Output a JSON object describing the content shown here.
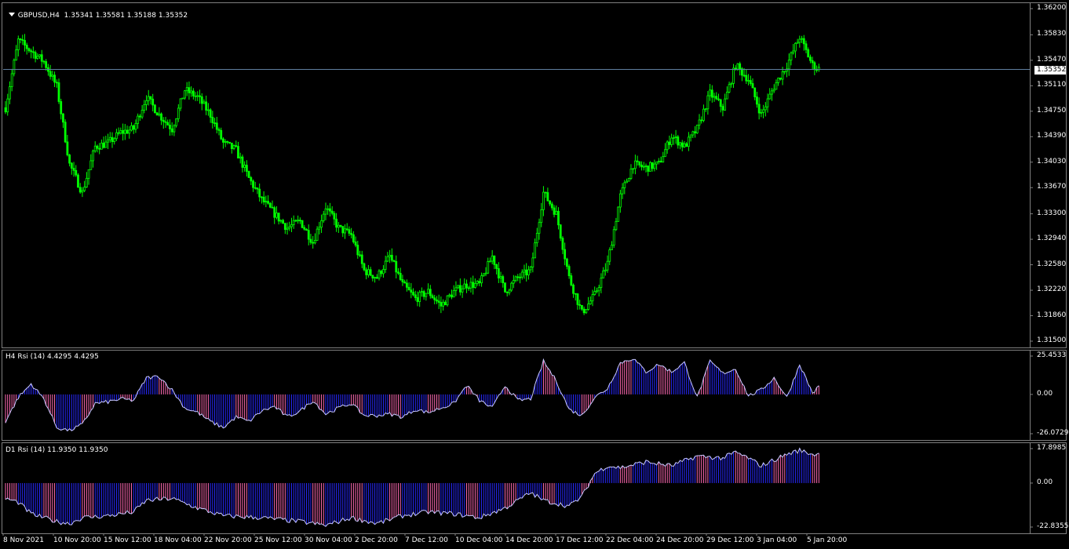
{
  "panels": {
    "main": {
      "symbol": "GBPUSD,H4",
      "ohlc": "1.35341 1.35581 1.35188 1.35352"
    },
    "h4": {
      "label": "H4 Rsi (14) 4.4295 4.4295"
    },
    "d1": {
      "label": "D1 Rsi (14) 11.9350 11.9350"
    }
  },
  "price_tag": "1.35352",
  "colors": {
    "bull": "#00ff00",
    "bear": "#00ff00",
    "hist_pos_a": "#ff69b4",
    "hist_pos_b": "#2828ff",
    "line": "#c8c8ff",
    "grid": "#808080",
    "price_line": "#5f7f9f"
  },
  "chart_data": [
    {
      "type": "candlestick",
      "title": "GBPUSD,H4",
      "ylim": [
        1.315,
        1.362
      ],
      "y_ticks": [
        "1.36200",
        "1.35830",
        "1.35470",
        "1.35110",
        "1.34750",
        "1.34390",
        "1.34030",
        "1.33670",
        "1.33300",
        "1.32940",
        "1.32580",
        "1.32220",
        "1.31860",
        "1.31500"
      ],
      "x_ticks": [
        "8 Nov 2021",
        "10 Nov 20:00",
        "15 Nov 12:00",
        "18 Nov 04:00",
        "22 Nov 20:00",
        "25 Nov 12:00",
        "30 Nov 04:00",
        "2 Dec 20:00",
        "7 Dec 12:00",
        "10 Dec 04:00",
        "14 Dec 20:00",
        "17 Dec 12:00",
        "22 Dec 04:00",
        "24 Dec 20:00",
        "29 Dec 12:00",
        "3 Jan 04:00",
        "5 Jan 20:00"
      ],
      "close_path": [
        [
          0,
          1.348
        ],
        [
          6,
          1.3575
        ],
        [
          12,
          1.356
        ],
        [
          18,
          1.3545
        ],
        [
          24,
          1.351
        ],
        [
          30,
          1.34
        ],
        [
          36,
          1.336
        ],
        [
          42,
          1.3425
        ],
        [
          48,
          1.343
        ],
        [
          54,
          1.3445
        ],
        [
          60,
          1.345
        ],
        [
          66,
          1.3495
        ],
        [
          72,
          1.347
        ],
        [
          78,
          1.345
        ],
        [
          84,
          1.3505
        ],
        [
          90,
          1.3495
        ],
        [
          96,
          1.347
        ],
        [
          102,
          1.343
        ],
        [
          108,
          1.342
        ],
        [
          114,
          1.338
        ],
        [
          120,
          1.335
        ],
        [
          126,
          1.333
        ],
        [
          132,
          1.331
        ],
        [
          138,
          1.332
        ],
        [
          144,
          1.329
        ],
        [
          150,
          1.334
        ],
        [
          156,
          1.331
        ],
        [
          162,
          1.33
        ],
        [
          168,
          1.325
        ],
        [
          174,
          1.324
        ],
        [
          180,
          1.327
        ],
        [
          186,
          1.323
        ],
        [
          192,
          1.321
        ],
        [
          198,
          1.322
        ],
        [
          204,
          1.32
        ],
        [
          210,
          1.322
        ],
        [
          216,
          1.323
        ],
        [
          222,
          1.323
        ],
        [
          228,
          1.327
        ],
        [
          234,
          1.322
        ],
        [
          240,
          1.324
        ],
        [
          246,
          1.325
        ],
        [
          252,
          1.336
        ],
        [
          258,
          1.333
        ],
        [
          264,
          1.324
        ],
        [
          270,
          1.319
        ],
        [
          276,
          1.3215
        ],
        [
          282,
          1.326
        ],
        [
          288,
          1.3355
        ],
        [
          294,
          1.34
        ],
        [
          300,
          1.3395
        ],
        [
          306,
          1.34
        ],
        [
          312,
          1.344
        ],
        [
          318,
          1.3425
        ],
        [
          324,
          1.345
        ],
        [
          330,
          1.35
        ],
        [
          336,
          1.348
        ],
        [
          342,
          1.354
        ],
        [
          348,
          1.352
        ],
        [
          354,
          1.347
        ],
        [
          360,
          1.351
        ],
        [
          366,
          1.354
        ],
        [
          372,
          1.358
        ],
        [
          378,
          1.354
        ],
        [
          381,
          1.3535
        ]
      ],
      "current_price": 1.35352
    },
    {
      "type": "histogram",
      "title": "H4 Rsi (14) 4.4295 4.4295",
      "ylim": [
        -26.0729,
        25.4533
      ],
      "y_ticks": [
        "25.4533",
        "0.00",
        "-26.0729"
      ],
      "path": [
        [
          0,
          -18
        ],
        [
          6,
          -2
        ],
        [
          12,
          7
        ],
        [
          18,
          -3
        ],
        [
          24,
          -22
        ],
        [
          30,
          -24
        ],
        [
          36,
          -20
        ],
        [
          42,
          -6
        ],
        [
          48,
          -5
        ],
        [
          54,
          -3
        ],
        [
          60,
          -4
        ],
        [
          66,
          11
        ],
        [
          72,
          12
        ],
        [
          78,
          3
        ],
        [
          84,
          -9
        ],
        [
          90,
          -12
        ],
        [
          96,
          -18
        ],
        [
          102,
          -22
        ],
        [
          108,
          -15
        ],
        [
          114,
          -18
        ],
        [
          120,
          -11
        ],
        [
          126,
          -8
        ],
        [
          132,
          -15
        ],
        [
          138,
          -11
        ],
        [
          144,
          -4
        ],
        [
          150,
          -13
        ],
        [
          156,
          -9
        ],
        [
          162,
          -6
        ],
        [
          168,
          -14
        ],
        [
          174,
          -14
        ],
        [
          180,
          -13
        ],
        [
          186,
          -15
        ],
        [
          192,
          -10
        ],
        [
          198,
          -12
        ],
        [
          204,
          -9
        ],
        [
          210,
          -6
        ],
        [
          216,
          6
        ],
        [
          222,
          -4
        ],
        [
          228,
          -9
        ],
        [
          234,
          6
        ],
        [
          240,
          -4
        ],
        [
          246,
          -3
        ],
        [
          252,
          22
        ],
        [
          258,
          9
        ],
        [
          264,
          -10
        ],
        [
          270,
          -14
        ],
        [
          276,
          -2
        ],
        [
          282,
          4
        ],
        [
          288,
          21
        ],
        [
          294,
          24
        ],
        [
          300,
          15
        ],
        [
          306,
          20
        ],
        [
          312,
          15
        ],
        [
          318,
          21
        ],
        [
          324,
          -2
        ],
        [
          330,
          22
        ],
        [
          336,
          14
        ],
        [
          342,
          17
        ],
        [
          348,
          -1
        ],
        [
          354,
          3
        ],
        [
          360,
          11
        ],
        [
          366,
          -2
        ],
        [
          372,
          20
        ],
        [
          378,
          1
        ],
        [
          381,
          5
        ]
      ]
    },
    {
      "type": "histogram",
      "title": "D1 Rsi (14) 11.9350 11.9350",
      "ylim": [
        -22.8355,
        17.8985
      ],
      "y_ticks": [
        "17.8985",
        "0.00",
        "-22.8355"
      ],
      "path": [
        [
          0,
          -8
        ],
        [
          6,
          -10
        ],
        [
          12,
          -16
        ],
        [
          24,
          -20
        ],
        [
          30,
          -21
        ],
        [
          36,
          -18
        ],
        [
          48,
          -17
        ],
        [
          60,
          -15
        ],
        [
          66,
          -9
        ],
        [
          78,
          -8
        ],
        [
          90,
          -13
        ],
        [
          102,
          -17
        ],
        [
          120,
          -18
        ],
        [
          138,
          -20
        ],
        [
          150,
          -22
        ],
        [
          162,
          -18
        ],
        [
          174,
          -21
        ],
        [
          186,
          -17
        ],
        [
          198,
          -15
        ],
        [
          210,
          -16
        ],
        [
          222,
          -18
        ],
        [
          234,
          -13
        ],
        [
          246,
          -5
        ],
        [
          252,
          -9
        ],
        [
          264,
          -12
        ],
        [
          270,
          -7
        ],
        [
          276,
          5
        ],
        [
          282,
          9
        ],
        [
          288,
          8
        ],
        [
          300,
          11
        ],
        [
          312,
          9
        ],
        [
          324,
          14
        ],
        [
          336,
          13
        ],
        [
          342,
          16
        ],
        [
          348,
          13
        ],
        [
          354,
          9
        ],
        [
          366,
          15
        ],
        [
          372,
          17
        ],
        [
          378,
          15
        ],
        [
          381,
          15
        ]
      ]
    }
  ]
}
